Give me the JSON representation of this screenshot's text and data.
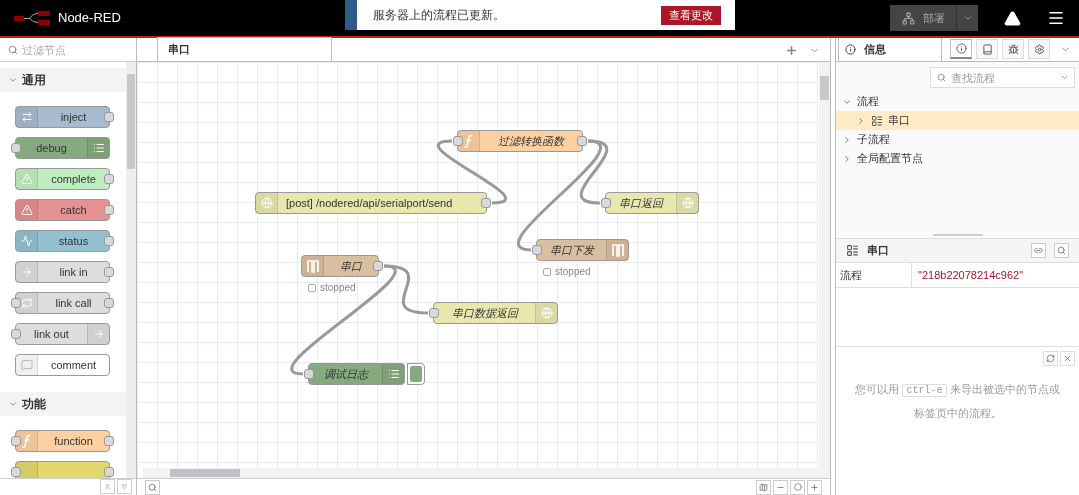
{
  "header": {
    "title": "Node-RED",
    "notification": {
      "message": "服务器上的流程已更新。",
      "action": "查看更改"
    },
    "deploy_button": "部署"
  },
  "palette": {
    "filter_placeholder": "过滤节点",
    "categories": [
      {
        "name": "通用",
        "expanded": true,
        "nodes": [
          {
            "label": "inject",
            "kind": "inject"
          },
          {
            "label": "debug",
            "kind": "debug"
          },
          {
            "label": "complete",
            "kind": "complete"
          },
          {
            "label": "catch",
            "kind": "catch"
          },
          {
            "label": "status",
            "kind": "status"
          },
          {
            "label": "link in",
            "kind": "link-in"
          },
          {
            "label": "link call",
            "kind": "link-call"
          },
          {
            "label": "link out",
            "kind": "link-out"
          },
          {
            "label": "comment",
            "kind": "comment"
          }
        ]
      },
      {
        "name": "功能",
        "expanded": true,
        "nodes": [
          {
            "label": "function",
            "kind": "function"
          },
          {
            "kind": "change"
          }
        ]
      }
    ]
  },
  "workspace": {
    "tabs": [
      {
        "label": "串口",
        "selected": true
      }
    ],
    "nodes": [
      {
        "label": "过滤转换函数",
        "kind": "function"
      },
      {
        "label": "[post] /nodered/api/serialport/send",
        "kind": "http-in"
      },
      {
        "label": "串口返回",
        "kind": "http-response"
      },
      {
        "label": "串口下发",
        "kind": "serial-out",
        "status": "stopped"
      },
      {
        "label": "串口",
        "kind": "serial-in",
        "status": "stopped"
      },
      {
        "label": "串口数据返回",
        "kind": "http-response"
      },
      {
        "label": "调试日志",
        "kind": "debug",
        "active": true
      }
    ]
  },
  "sidebar": {
    "tab": {
      "label": "信息",
      "selected": true
    },
    "tool_tabs": [
      {
        "kind": "info",
        "selected": true
      },
      {
        "kind": "help",
        "selected": false
      },
      {
        "kind": "debug",
        "selected": false
      },
      {
        "kind": "config",
        "selected": false
      }
    ],
    "search_placeholder": "查找流程",
    "tree": [
      {
        "label": "流程",
        "expanded": true,
        "selected": false,
        "children": [
          {
            "label": "串口",
            "expanded": false,
            "selected": true
          }
        ]
      },
      {
        "label": "子流程",
        "expanded": false,
        "selected": false
      },
      {
        "label": "全局配置节点",
        "expanded": false,
        "selected": false
      }
    ],
    "info": {
      "title": "串口",
      "properties": [
        {
          "name": "流程",
          "value": "\"218b22078214c962\""
        }
      ]
    },
    "help": {
      "before": "您可以用",
      "shortcut": "ctrl-e",
      "after": "来导出被选中的节点或标签页中的流程。"
    }
  }
}
